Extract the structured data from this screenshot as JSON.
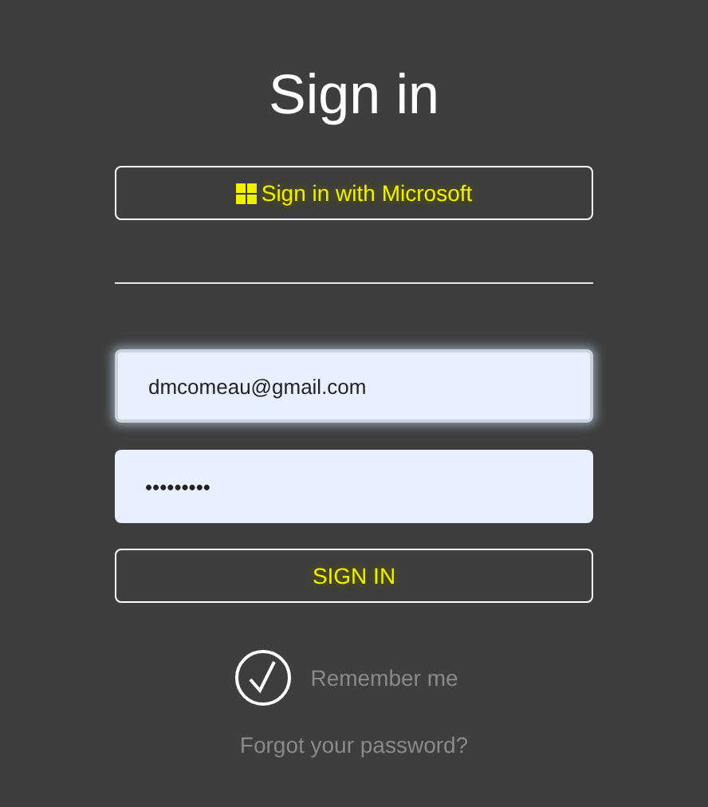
{
  "title": "Sign in",
  "microsoft_button": {
    "label": "Sign in with Microsoft"
  },
  "email": {
    "value": "dmcomeau@gmail.com"
  },
  "password": {
    "value": "•••••••••"
  },
  "submit_button": {
    "label": "SIGN IN"
  },
  "remember": {
    "label": "Remember me",
    "checked": true
  },
  "forgot_link": "Forgot your password?"
}
